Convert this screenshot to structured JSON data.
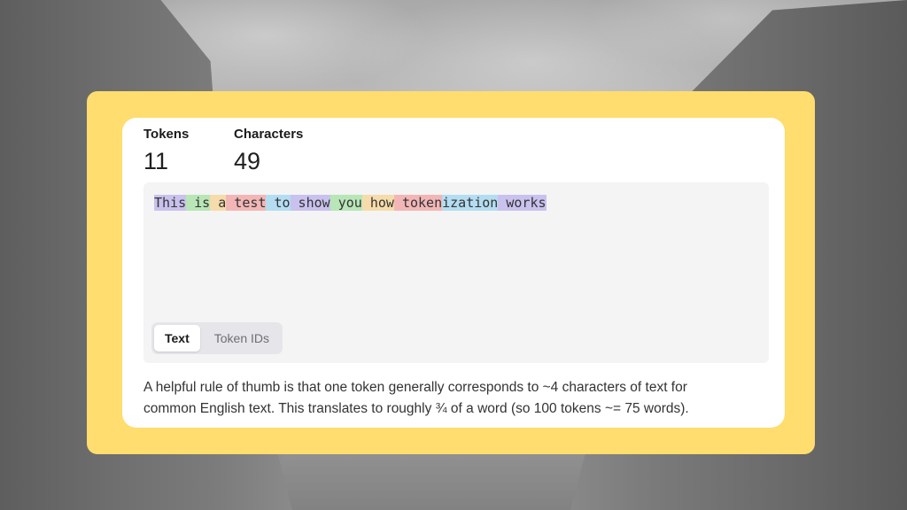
{
  "stats": {
    "tokens_label": "Tokens",
    "tokens_value": "11",
    "characters_label": "Characters",
    "characters_value": "49"
  },
  "tokens": [
    {
      "text": "This",
      "color": "#c9c2ee"
    },
    {
      "text": " is",
      "color": "#b8e6b6"
    },
    {
      "text": " a",
      "color": "#f6dcaa"
    },
    {
      "text": " test",
      "color": "#f3b6b6"
    },
    {
      "text": " to",
      "color": "#b4ddf2"
    },
    {
      "text": " show",
      "color": "#c9c2ee"
    },
    {
      "text": " you",
      "color": "#b8e6b6"
    },
    {
      "text": " how",
      "color": "#f6dcaa"
    },
    {
      "text": " token",
      "color": "#f3b6b6"
    },
    {
      "text": "ization",
      "color": "#b4ddf2"
    },
    {
      "text": " works",
      "color": "#c9c2ee"
    }
  ],
  "tabs": {
    "text": "Text",
    "token_ids": "Token IDs",
    "active": "Text"
  },
  "note": {
    "line1": "A helpful rule of thumb is that one token generally corresponds to ~4 characters of text for",
    "line2": "common English text. This translates to roughly ¾ of a word (so 100 tokens ~= 75 words)."
  },
  "colors": {
    "frame": "#ffdd6e",
    "card": "#ffffff",
    "textarea": "#f4f4f4"
  }
}
